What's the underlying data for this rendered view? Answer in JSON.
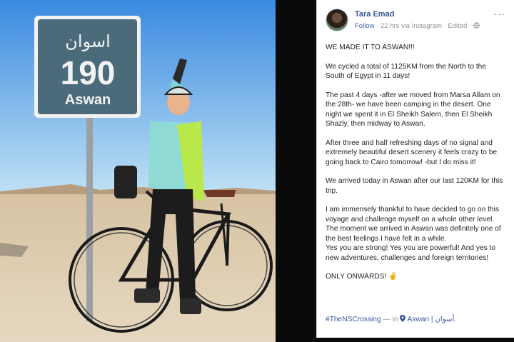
{
  "photo": {
    "sign": {
      "arabic": "اسوان",
      "number": "190",
      "latin": "Aswan"
    },
    "colors": {
      "sky_top": "#3f8fe0",
      "sky_bottom": "#b9dcf2",
      "sand": "#d8c7a9",
      "sign_face": "#4b6b7a"
    }
  },
  "post": {
    "author": "Tara Emad",
    "follow_label": "Follow",
    "meta_rest": "· 22 hrs via Instagram · Edited ·",
    "more_label": "···",
    "paragraphs": [
      "WE MADE IT TO ASWAN!!!",
      "We cycled a total of 1125KM from the North to the South of Egypt in 11 days!",
      "The past 4 days -after we moved from Marsa Allam on the 28th- we have been camping in the desert. One night we spent it in El Sheikh Salem, then El Sheikh Shazly, then midway to Aswan.",
      "After three and half refreshing days of no signal and extremely beautiful desert scenery it feels crazy to be going back to Cairo tomorrow! -but I do miss it!",
      "We arrived today in Aswan after our last 120KM for this trip.",
      "I am immensely thankful to have decided to go on this voyage and challenge myself on a whole other level. The moment we arrived in Aswan was definitely one of the best feelings I have felt in a while.",
      "Yes you are strong! Yes you are powerful! And yes to new adventures, challenges and foreign territories!",
      "ONLY ONWARDS! ✌"
    ],
    "hashtag": "#TheNSCrossing",
    "in_label": "— in",
    "place": "Aswan | أسوان."
  },
  "colors": {
    "link": "#365899",
    "meta": "#90949c",
    "text": "#1d2129"
  }
}
